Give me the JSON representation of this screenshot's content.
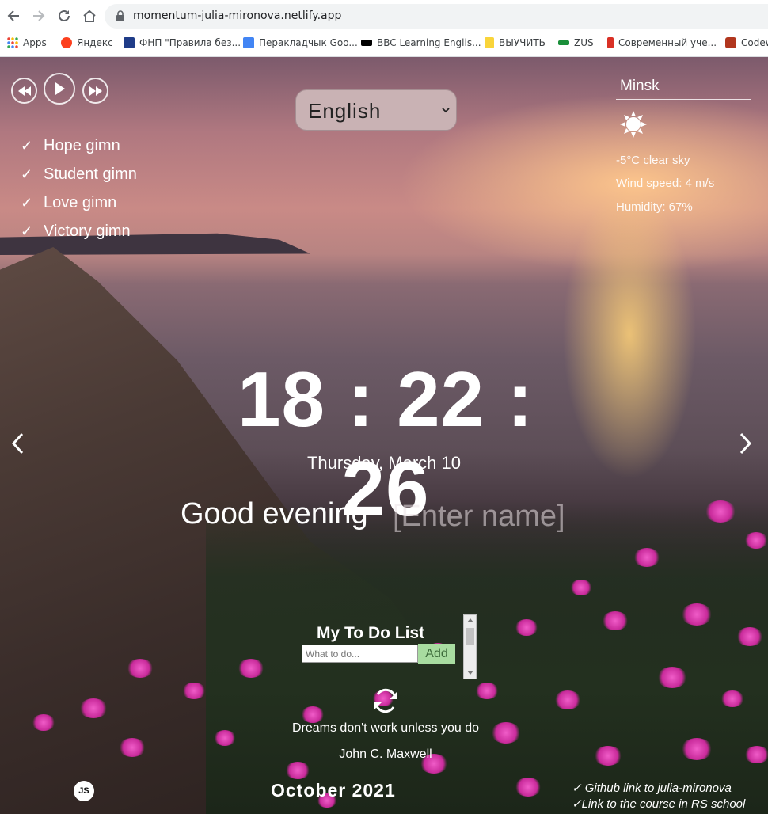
{
  "browser": {
    "url": "momentum-julia-mironova.netlify.app",
    "bookmarks": [
      {
        "label": "Apps",
        "icon": "apps-grid-icon",
        "color": "#4285f4"
      },
      {
        "label": "Яндекс",
        "icon": "yandex-icon",
        "color": "#fc3f1d"
      },
      {
        "label": "ФНП \"Правила без...",
        "icon": "fnp-icon",
        "color": "#1f3c88"
      },
      {
        "label": "Перакладчык Goo...",
        "icon": "translate-icon",
        "color": "#4285f4"
      },
      {
        "label": "BBC Learning Englis...",
        "icon": "bbc-icon",
        "color": "#000000"
      },
      {
        "label": "ВЫУЧИТЬ",
        "icon": "folder-icon",
        "color": "#f9d43a"
      },
      {
        "label": "ZUS",
        "icon": "zus-icon",
        "color": "#1a8f3a"
      },
      {
        "label": "Современный уче...",
        "icon": "person-icon",
        "color": "#d93025"
      },
      {
        "label": "Codew",
        "icon": "codewars-icon",
        "color": "#b1361e"
      }
    ]
  },
  "player": {
    "playlist": [
      "Hope gimn",
      "Student gimn",
      "Love gimn",
      "Victory gimn"
    ],
    "check": "✓"
  },
  "language": {
    "selected": "English"
  },
  "weather": {
    "city": "Minsk",
    "icon": "sun-icon",
    "description": "-5°C  clear sky",
    "wind": "Wind speed: 4 m/s",
    "humidity": "Humidity: 67%"
  },
  "clock": {
    "time": "18 : 22 : 26"
  },
  "date": "Thursday, March 10",
  "greeting": {
    "text": "Good evening",
    "name_placeholder": "[Enter name]"
  },
  "todo": {
    "title": "My To Do List",
    "placeholder": "What to do...",
    "add_label": "Add"
  },
  "quote": {
    "text": "Dreams don't work unless you do",
    "author": "John C. Maxwell"
  },
  "footer": {
    "logo": "JS",
    "year": "October 2021",
    "links": [
      "✓  Github link to julia-mironova",
      "✓Link to the course in RS school"
    ]
  }
}
